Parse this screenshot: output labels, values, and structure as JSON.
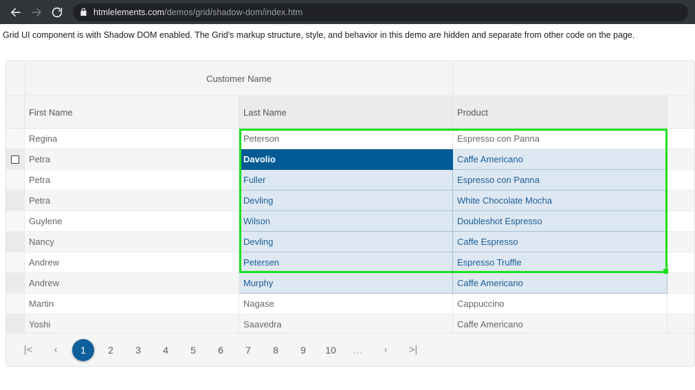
{
  "browser": {
    "back_icon": "arrow-left-icon",
    "forward_icon": "arrow-right-icon",
    "reload_icon": "reload-icon",
    "lock_icon": "lock-icon",
    "url_host": "htmlelements.com",
    "url_path": "/demos/grid/shadow-dom/index.htm"
  },
  "page": {
    "description": "Grid UI component is with Shadow DOM enabled. The Grid's markup structure, style, and behavior in this demo are hidden and separate from other code on the page."
  },
  "grid": {
    "group_header": "Customer Name",
    "columns": [
      {
        "key": "first",
        "label": "First Name",
        "active": false
      },
      {
        "key": "last",
        "label": "Last Name",
        "active": true
      },
      {
        "key": "prod",
        "label": "Product",
        "active": true
      }
    ],
    "rows": [
      {
        "first": "Regina",
        "last": "Peterson",
        "product": "Espresso con Panna",
        "checkbox": false,
        "last_state": "none",
        "product_state": "none"
      },
      {
        "first": "Petra",
        "last": "Davolio",
        "product": "Caffe Americano",
        "checkbox": true,
        "last_state": "focused",
        "product_state": "selected"
      },
      {
        "first": "Petra",
        "last": "Fuller",
        "product": "Espresso con Panna",
        "checkbox": false,
        "last_state": "selected",
        "product_state": "selected"
      },
      {
        "first": "Petra",
        "last": "Devling",
        "product": "White Chocolate Mocha",
        "checkbox": false,
        "last_state": "selected",
        "product_state": "selected"
      },
      {
        "first": "Guylene",
        "last": "Wilson",
        "product": "Doubleshot Espresso",
        "checkbox": false,
        "last_state": "selected",
        "product_state": "selected"
      },
      {
        "first": "Nancy",
        "last": "Devling",
        "product": "Caffe Espresso",
        "checkbox": false,
        "last_state": "selected",
        "product_state": "selected"
      },
      {
        "first": "Andrew",
        "last": "Petersen",
        "product": "Espresso Truffle",
        "checkbox": false,
        "last_state": "selected",
        "product_state": "selected"
      },
      {
        "first": "Andrew",
        "last": "Murphy",
        "product": "Caffe Americano",
        "checkbox": false,
        "last_state": "selected",
        "product_state": "selected"
      },
      {
        "first": "Martin",
        "last": "Nagase",
        "product": "Cappuccino",
        "checkbox": false,
        "last_state": "none",
        "product_state": "none"
      },
      {
        "first": "Yoshi",
        "last": "Saavedra",
        "product": "Caffe Americano",
        "checkbox": false,
        "last_state": "none",
        "product_state": "none"
      }
    ],
    "selection": {
      "border_color": "#1ee01e",
      "focused_cell_bg": "#015a94",
      "selected_cell_bg": "#dee8f3",
      "selected_cell_text": "#1b5d94"
    }
  },
  "pagination": {
    "first_label": "|<",
    "prev_label": "‹",
    "pages": [
      "1",
      "2",
      "3",
      "4",
      "5",
      "6",
      "7",
      "8",
      "9",
      "10"
    ],
    "ellipsis": "...",
    "next_label": "›",
    "last_label": ">|",
    "current_page": "1",
    "accent_color": "#0f5e9c"
  }
}
